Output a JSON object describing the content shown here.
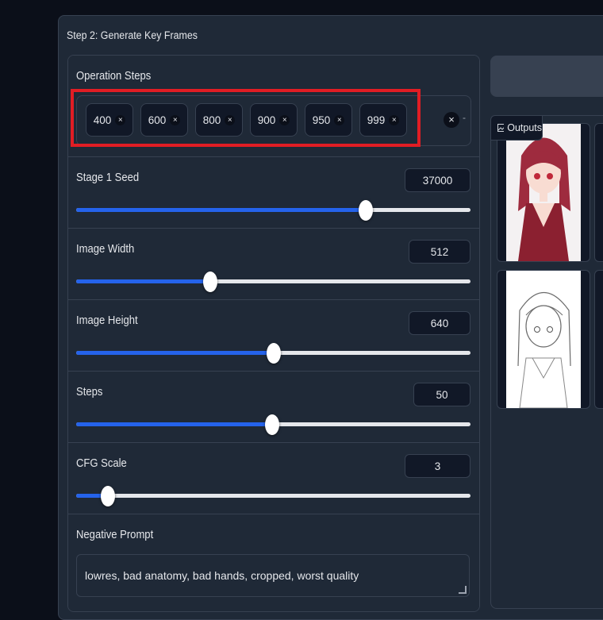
{
  "panel": {
    "title": "Step 2: Generate Key Frames"
  },
  "operation_steps": {
    "label": "Operation Steps",
    "tags": [
      "400",
      "600",
      "800",
      "900",
      "950",
      "999"
    ],
    "remove_symbol": "×",
    "clear_all_symbol": "×",
    "trailing": "-"
  },
  "sliders": [
    {
      "label": "Stage 1 Seed",
      "value": "37000",
      "fraction": 0.734
    },
    {
      "label": "Image Width",
      "value": "512",
      "fraction": 0.34
    },
    {
      "label": "Image Height",
      "value": "640",
      "fraction": 0.5
    },
    {
      "label": "Steps",
      "value": "50",
      "fraction": 0.497
    },
    {
      "label": "CFG Scale",
      "value": "3",
      "fraction": 0.08
    }
  ],
  "negative_prompt": {
    "label": "Negative Prompt",
    "value": "lowres, bad anatomy, bad hands, cropped, worst quality"
  },
  "outputs": {
    "label": "Outputs"
  },
  "colors": {
    "accent": "#2563eb",
    "highlight": "#e11d24",
    "background": "#0b0f19"
  }
}
